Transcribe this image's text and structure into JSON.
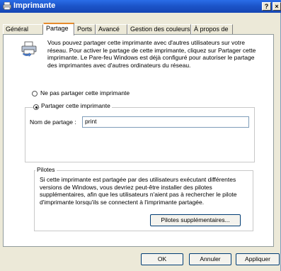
{
  "window": {
    "title": "Imprimante",
    "help_label": "?",
    "close_label": "×"
  },
  "tabs": [
    {
      "label": "Général"
    },
    {
      "label": "Partage"
    },
    {
      "label": "Ports"
    },
    {
      "label": "Avancé"
    },
    {
      "label": "Gestion des couleurs"
    },
    {
      "label": "À propos de"
    }
  ],
  "active_tab": "Partage",
  "intro": {
    "icon": "printer-share-icon",
    "text": "Vous pouvez partager cette imprimante avec d'autres utilisateurs sur votre réseau. Pour activer le partage de cette imprimante, cliquez sur Partager cette imprimante.  Le Pare-feu Windows est déjà configuré pour autoriser le partage des imprimantes avec d'autres ordinateurs du réseau."
  },
  "sharing": {
    "option_no_share": "Ne pas partager cette imprimante",
    "option_share": "Partager cette imprimante",
    "selected": "share",
    "share_name_label": "Nom de partage :",
    "share_name_value": "print"
  },
  "drivers": {
    "group_label": "Pilotes",
    "text": "Si cette imprimante est partagée par des utilisateurs exécutant différentes versions de Windows, vous devriez peut-être installer des pilotes supplémentaires, afin que les utilisateurs n'aient pas à rechercher le pilote d'imprimante lorsqu'ils se connectent à l'imprimante partagée.",
    "additional_drivers_button": "Pilotes supplémentaires..."
  },
  "footer": {
    "ok_label": "OK",
    "cancel_label": "Annuler",
    "apply_label": "Appliquer"
  },
  "colors": {
    "titlebar": "#1b53c7",
    "dialog_bg": "#ece9d8",
    "active_tab_accent": "#e68b2c"
  }
}
